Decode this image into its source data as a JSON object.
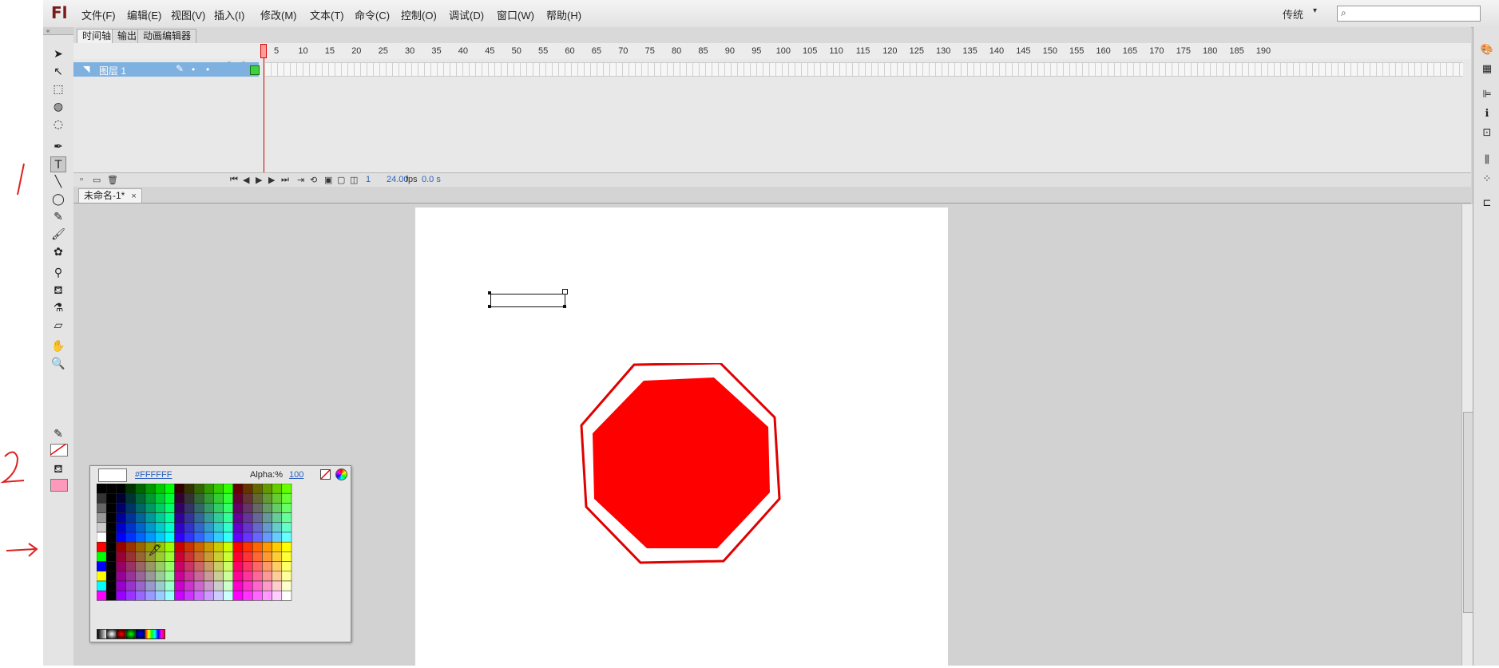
{
  "annotations": {
    "mark_1": "1",
    "mark_2": "2",
    "arrow": "→"
  },
  "app": {
    "logo": "Fl",
    "workspace": "传统",
    "workspace_caret": "▾"
  },
  "menu": [
    "文件(F)",
    "编辑(E)",
    "视图(V)",
    "插入(I)",
    "修改(M)",
    "文本(T)",
    "命令(C)",
    "控制(O)",
    "调试(D)",
    "窗口(W)",
    "帮助(H)"
  ],
  "search": {
    "placeholder": ""
  },
  "timeline": {
    "tabs": [
      "时间轴",
      "输出",
      "动画编辑器"
    ],
    "active_tab": "时间轴",
    "ruler": [
      "1",
      "5",
      "10",
      "15",
      "20",
      "25",
      "30",
      "35",
      "40",
      "45",
      "50",
      "55",
      "60",
      "65",
      "70",
      "75",
      "80",
      "85",
      "90",
      "95",
      "100",
      "105",
      "110",
      "115",
      "120",
      "125",
      "130",
      "135",
      "140",
      "145",
      "150",
      "155",
      "160",
      "165",
      "170",
      "175",
      "180",
      "185",
      "190"
    ],
    "layer": {
      "name": "图层 1"
    },
    "status": {
      "frame": "1",
      "fps": "24.00",
      "fps_unit": "fps",
      "time": "0.0 s"
    }
  },
  "document": {
    "tab_title": "未命名-1*",
    "close_glyph": "×"
  },
  "stage": {
    "shape_fill": "#ff0000",
    "shape_stroke": "#e00000",
    "background": "#ffffff"
  },
  "swatches": {
    "current_hex": "#FFFFFF",
    "alpha_label": "Alpha:%",
    "alpha_value": "100"
  },
  "icons": {
    "tools": [
      "selection-tool-icon",
      "subselection-tool-icon",
      "free-transform-tool-icon",
      "3d-rotation-tool-icon",
      "lasso-tool-icon",
      "pen-tool-icon",
      "text-tool-icon",
      "line-tool-icon",
      "oval-tool-icon",
      "pencil-tool-icon",
      "brush-tool-icon",
      "deco-tool-icon",
      "bone-tool-icon",
      "paint-bucket-tool-icon",
      "eyedropper-tool-icon",
      "eraser-tool-icon",
      "hand-tool-icon",
      "zoom-tool-icon",
      "stroke-color-icon",
      "fill-color-icon"
    ],
    "right_panel": [
      "color-panel-icon",
      "swatches-panel-icon",
      "align-panel-icon",
      "info-panel-icon",
      "transform-panel-icon",
      "library-panel-icon",
      "motion-presets-icon",
      "components-icon"
    ]
  }
}
